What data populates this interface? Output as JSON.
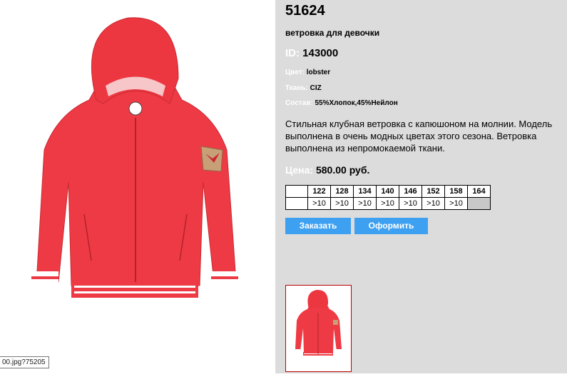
{
  "product": {
    "code": "51624",
    "name": "ветровка для девочки",
    "id_label": "ID:",
    "id_value": "143000",
    "color_label": "Цвет:",
    "color_value": "lobster",
    "fabric_label": "Ткань:",
    "fabric_value": "CIZ",
    "composition_label": "Состав:",
    "composition_value": "55%Хлопок,45%Нейлон",
    "description": "Стильная клубная ветровка с капюшоном на молнии. Модель выполнена в очень модных цветах этого сезона. Ветровка выполнена из непромокаемой ткани.",
    "price_label": "Цена:",
    "price_value": "580.00 руб."
  },
  "sizes": {
    "headers": [
      "122",
      "128",
      "134",
      "140",
      "146",
      "152",
      "158",
      "164"
    ],
    "availability": [
      ">10",
      ">10",
      ">10",
      ">10",
      ">10",
      ">10",
      ">10",
      ""
    ]
  },
  "buttons": {
    "order": "Заказать",
    "checkout": "Оформить"
  },
  "tooltip": {
    "url": "00.jpg?75205"
  },
  "colors": {
    "jacket": "#ee3a44",
    "panel_bg": "#dcdcdc",
    "button_bg": "#3ea0f0",
    "thumb_border": "#c00000"
  }
}
